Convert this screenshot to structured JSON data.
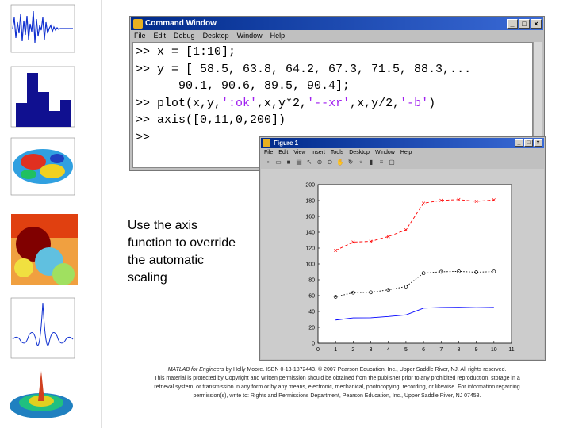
{
  "command_window": {
    "title": "Command Window",
    "menu": [
      "File",
      "Edit",
      "Debug",
      "Desktop",
      "Window",
      "Help"
    ],
    "lines": [
      [
        {
          "t": ">> x = [1:10];"
        }
      ],
      [
        {
          "t": ">> y = [ 58.5, 63.8, 64.2, 67.3, 71.5, 88.3,..."
        }
      ],
      [
        {
          "t": "      90.1, 90.6, 89.5, 90.4];"
        }
      ],
      [
        {
          "t": ">> plot(x,y,"
        },
        {
          "t": "':ok'",
          "s": 1
        },
        {
          "t": ",x,y*2,"
        },
        {
          "t": "'--xr'",
          "s": 1
        },
        {
          "t": ",x,y/2,"
        },
        {
          "t": "'-b'",
          "s": 1
        },
        {
          "t": ")"
        }
      ],
      [
        {
          "t": ">> axis([0,11,0,200])"
        }
      ],
      [
        {
          "t": ">>"
        }
      ]
    ]
  },
  "caption": "Use the axis function to override the automatic scaling",
  "figure_window": {
    "title": "Figure 1",
    "menu": [
      "File",
      "Edit",
      "View",
      "Insert",
      "Tools",
      "Desktop",
      "Window",
      "Help"
    ]
  },
  "chart_data": {
    "type": "line",
    "x": [
      1,
      2,
      3,
      4,
      5,
      6,
      7,
      8,
      9,
      10
    ],
    "series": [
      {
        "style": ":ok",
        "color": "#000000",
        "values": [
          58.5,
          63.8,
          64.2,
          67.3,
          71.5,
          88.3,
          90.1,
          90.6,
          89.5,
          90.4
        ]
      },
      {
        "style": "--xr",
        "color": "#ff0000",
        "values": [
          117,
          127.6,
          128.4,
          134.6,
          143,
          176.6,
          180.2,
          181.2,
          179,
          180.8
        ]
      },
      {
        "style": "-b",
        "color": "#0000ff",
        "values": [
          29.25,
          31.9,
          32.1,
          33.65,
          35.75,
          44.15,
          45.05,
          45.3,
          44.75,
          45.2
        ]
      }
    ],
    "xlim": [
      0,
      11
    ],
    "ylim": [
      0,
      200
    ],
    "xticks": [
      "0",
      "1",
      "2",
      "3",
      "4",
      "5",
      "6",
      "7",
      "8",
      "9",
      "10",
      "11"
    ],
    "yticks": [
      "0",
      "20",
      "40",
      "60",
      "80",
      "100",
      "120",
      "140",
      "160",
      "180",
      "200"
    ],
    "grid": false,
    "title": "",
    "xlabel": "",
    "ylabel": ""
  },
  "footer": {
    "line1_title": "MATLAB for Engineers",
    "line1_rest": " by Holly Moore. ISBN 0-13-1872443. © 2007 Pearson Education, Inc., Upper Saddle River, NJ. All rights reserved.",
    "line2": "This material is protected by Copyright and written permission should be obtained from the publisher prior to any prohibited reproduction, storage in a",
    "line3": "retrieval system, or transmission in any form or by any means, electronic, mechanical, photocopying, recording, or likewise. For information regarding",
    "line4": "permission(s), write to: Rights and Permissions Department, Pearson Education, Inc., Upper Saddle River, NJ 07458."
  }
}
